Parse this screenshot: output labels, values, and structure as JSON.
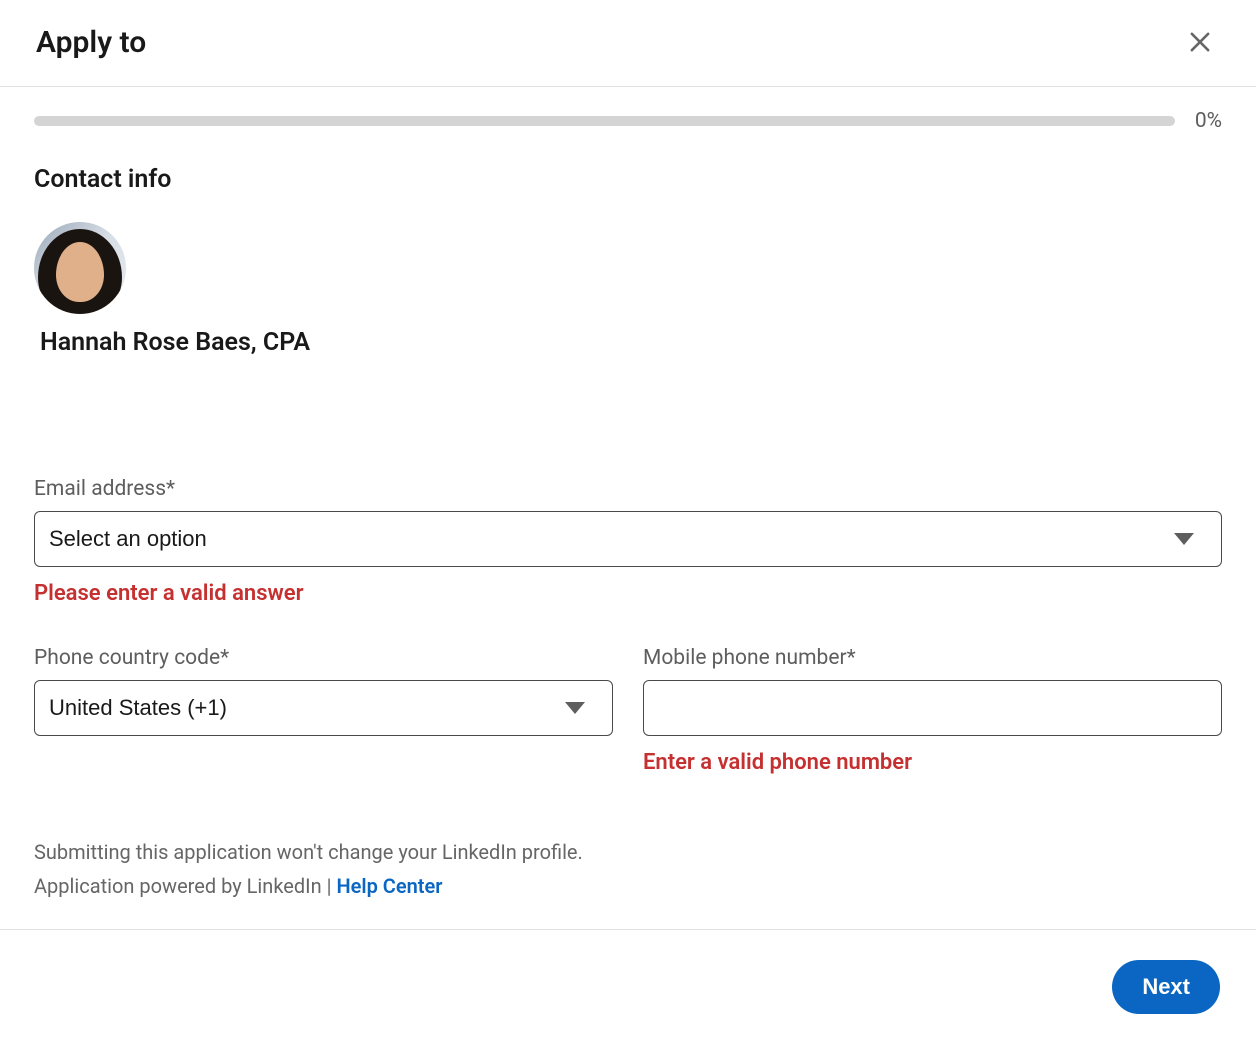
{
  "header": {
    "title": "Apply to"
  },
  "progress": {
    "percent_label": "0%"
  },
  "section": {
    "title": "Contact info"
  },
  "applicant": {
    "name": "Hannah Rose Baes, CPA"
  },
  "email": {
    "label": "Email address*",
    "selected": "Select an option",
    "error": "Please enter a valid answer"
  },
  "phone_code": {
    "label": "Phone country code*",
    "selected": "United States (+1)"
  },
  "phone_number": {
    "label": "Mobile phone number*",
    "value": "",
    "error": "Enter a valid phone number"
  },
  "footer_notes": {
    "line1": "Submitting this application won't change your LinkedIn profile.",
    "line2_prefix": "Application powered by LinkedIn | ",
    "help_link": "Help Center"
  },
  "actions": {
    "next": "Next"
  }
}
